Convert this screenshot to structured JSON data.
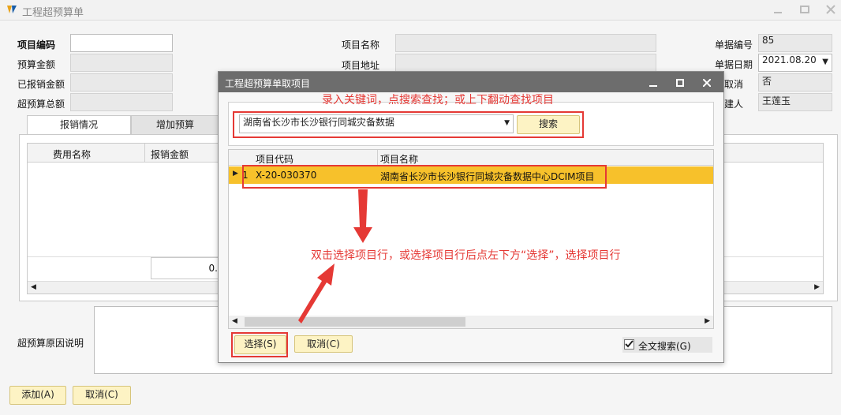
{
  "window": {
    "title": "工程超预算单"
  },
  "form": {
    "project_code_label": "项目编码",
    "budget_amount_label": "预算金额",
    "reimbursed_amount_label": "已报销金额",
    "over_budget_total_label": "超预算总额",
    "project_name_label": "项目名称",
    "project_address_label": "项目地址",
    "doc_number_label": "单据编号",
    "doc_number_value": "85",
    "doc_date_label": "单据日期",
    "doc_date_value": "2021.08.20",
    "cancel_partial_label": "取消",
    "cancel_value": "否",
    "creator_partial_label": "建人",
    "creator_value": "王莲玉"
  },
  "tabs": [
    {
      "label": "报销情况"
    },
    {
      "label": "增加预算"
    }
  ],
  "grid": {
    "columns": [
      "费用名称",
      "报销金额"
    ],
    "footer_total_partial": "0."
  },
  "reason_label": "超预算原因说明",
  "bottom_buttons": {
    "add": "添加(A)",
    "cancel": "取消(C)"
  },
  "dialog": {
    "title": "工程超预算单取项目",
    "search_value": "湖南省长沙市长沙银行同城灾备数据",
    "search_button": "搜索",
    "columns": [
      "项目代码",
      "项目名称"
    ],
    "rows": [
      {
        "index": "1",
        "code": "X-20-030370",
        "name": "湖南省长沙市长沙银行同城灾备数据中心DCIM项目"
      }
    ],
    "select_button": "选择(S)",
    "cancel_button": "取消(C)",
    "fulltext_label": "全文搜索(G)",
    "fulltext_checked": true
  },
  "annotations": {
    "hint_top": "录入关键词，点搜索查找；或上下翻动查找项目",
    "hint_middle": "双击选择项目行，或选择项目行后点左下方“选择”，选择项目行"
  },
  "colors": {
    "highlight_row": "#f7c12b",
    "button": "#fdf3c4",
    "annotation": "#e53935"
  }
}
